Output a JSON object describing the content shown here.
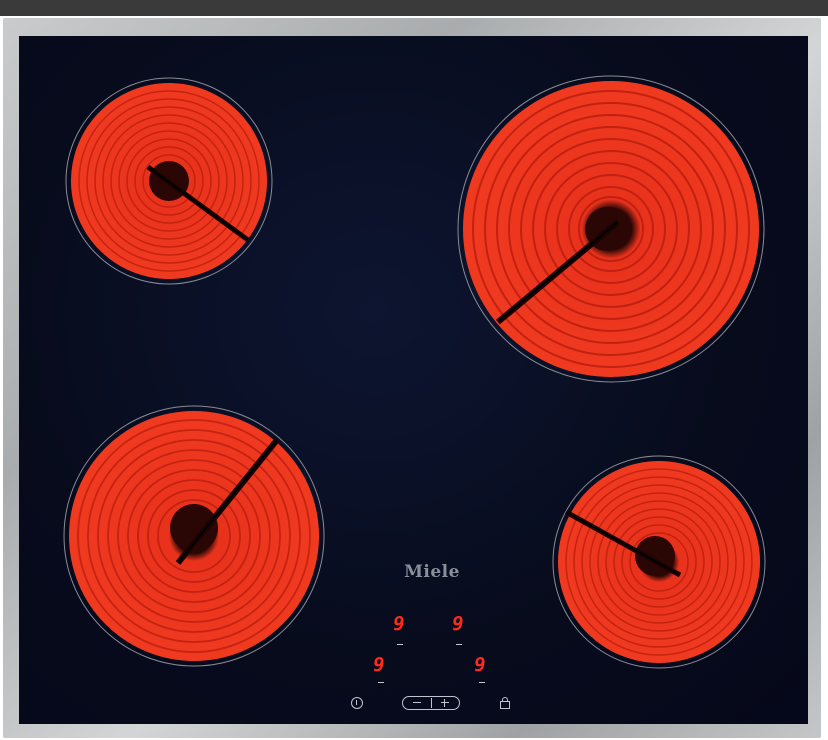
{
  "brand": {
    "name": "Miele"
  },
  "colors": {
    "glass": "#070b1c",
    "frame": "#b5b8ba",
    "element_glow": "#ff2a14",
    "display_red": "#ff2a1a",
    "controls": "#c0c4cc"
  },
  "displays": [
    {
      "id": "front-left-top",
      "value": "9"
    },
    {
      "id": "rear-right",
      "value": "9"
    },
    {
      "id": "rear-left",
      "value": "9"
    },
    {
      "id": "front-right",
      "value": "9"
    }
  ],
  "controls": [
    {
      "name": "power-icon"
    },
    {
      "name": "minus-plus-slider"
    },
    {
      "name": "lock-icon"
    }
  ],
  "zones": [
    {
      "name": "rear-left-zone",
      "state": "glowing"
    },
    {
      "name": "rear-right-zone",
      "state": "glowing"
    },
    {
      "name": "front-left-zone",
      "state": "glowing"
    },
    {
      "name": "front-right-zone",
      "state": "glowing"
    }
  ]
}
